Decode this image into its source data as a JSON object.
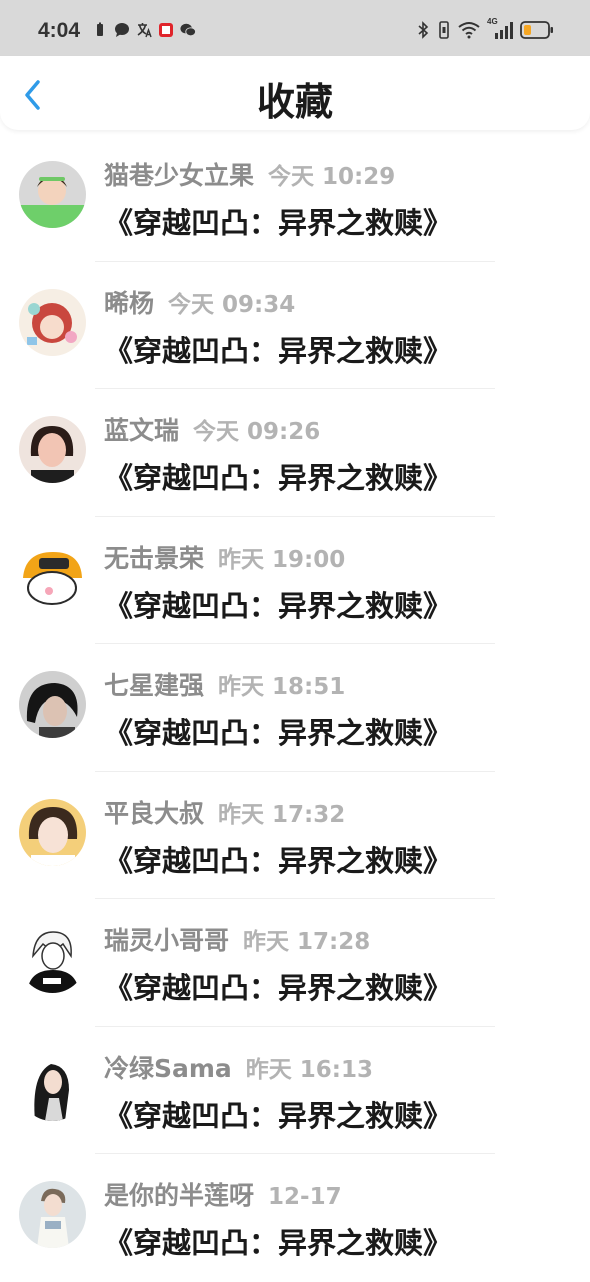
{
  "status_bar": {
    "time": "4:04",
    "left_icons": [
      "battery-small-icon",
      "chat-bubble-icon",
      "translate-icon",
      "red-app-icon",
      "wechat-icon"
    ],
    "right_icons": [
      "bluetooth-icon",
      "vibrate-icon",
      "wifi-icon",
      "signal-4g-icon",
      "battery-low-icon"
    ],
    "signal_label": "4G",
    "battery_color": "#f5a623"
  },
  "header": {
    "title": "收藏",
    "back_icon": "chevron-left-icon",
    "accent": "#2f9be8"
  },
  "items": [
    {
      "username": "猫巷少女立果",
      "time": "今天 10:29",
      "title": "《穿越凹凸：异界之救赎》",
      "avatar": "avatar-girl-green"
    },
    {
      "username": "晞杨",
      "time": "今天 09:34",
      "title": "《穿越凹凸：异界之救赎》",
      "avatar": "avatar-anime-girl"
    },
    {
      "username": "蓝文瑞",
      "time": "今天 09:26",
      "title": "《穿越凹凸：异界之救赎》",
      "avatar": "avatar-woman"
    },
    {
      "username": "无击景荣",
      "time": "昨天 19:00",
      "title": "《穿越凹凸：异界之救赎》",
      "avatar": "avatar-cartoon-helmet"
    },
    {
      "username": "七星建强",
      "time": "昨天 18:51",
      "title": "《穿越凹凸：异界之救赎》",
      "avatar": "avatar-dark-hair"
    },
    {
      "username": "平良大叔",
      "time": "昨天 17:32",
      "title": "《穿越凹凸：异界之救赎》",
      "avatar": "avatar-selfie"
    },
    {
      "username": "瑞灵小哥哥",
      "time": "昨天 17:28",
      "title": "《穿越凹凸：异界之救赎》",
      "avatar": "avatar-sketch-boy"
    },
    {
      "username": "冷绿Sama",
      "time": "昨天 16:13",
      "title": "《穿越凹凸：异界之救赎》",
      "avatar": "avatar-longhair-man"
    },
    {
      "username": "是你的半莲呀",
      "time": "12-17",
      "title": "《穿越凹凸：异界之救赎》",
      "avatar": "avatar-boy-white"
    }
  ]
}
